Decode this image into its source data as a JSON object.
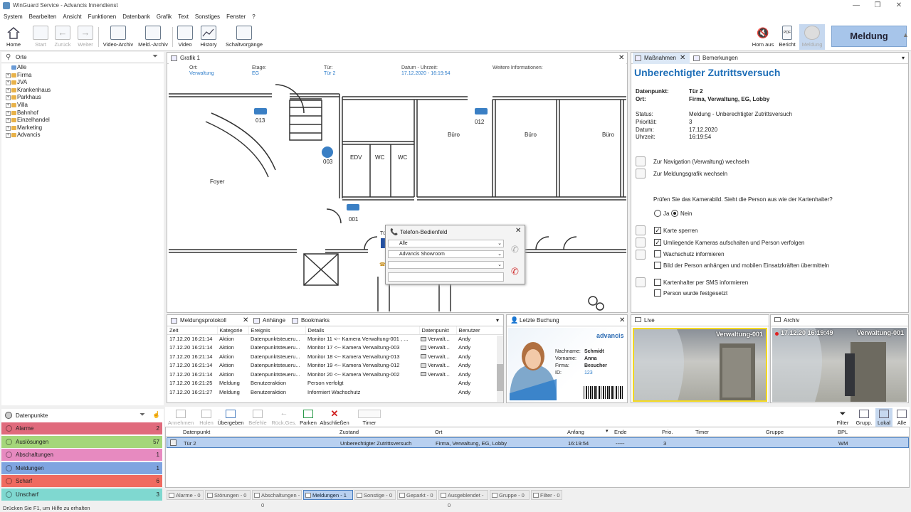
{
  "window": {
    "title": "WinGuard Service - Advancis Innendienst"
  },
  "menu": [
    "System",
    "Bearbeiten",
    "Ansicht",
    "Funktionen",
    "Datenbank",
    "Grafik",
    "Text",
    "Sonstiges",
    "Fenster",
    "?"
  ],
  "toolbar": {
    "home": "Home",
    "start": "Start",
    "back": "Zurück",
    "forward": "Weiter",
    "video_archive": "Video-Archiv",
    "event_archive": "Meld.-Archiv",
    "video": "Video",
    "history": "History",
    "switching": "Schaltvorgänge",
    "horn_off": "Horn aus",
    "report": "Bericht",
    "meldung": "Meldung",
    "meldung_big": "Meldung"
  },
  "locations": {
    "title": "Orte",
    "items": [
      "Alle",
      "Firma",
      "JVA",
      "Krankenhaus",
      "Parkhaus",
      "Villa",
      "Bahnhof",
      "Einzelhandel",
      "Marketing",
      "Advancis"
    ]
  },
  "grafik": {
    "tab": "Grafik 1",
    "info": {
      "ort_label": "Ort:",
      "ort": "Verwaltung",
      "etage_label": "Etage:",
      "etage": "EG",
      "tuer_label": "Tür:",
      "tuer": "Tür 2",
      "datum_label": "Datum - Uhrzeit:",
      "datum": "17.12.2020 - 16:19:54",
      "weitere_label": "Weitere Informationen:"
    },
    "rooms": [
      "Büro",
      "Büro",
      "Büro",
      "EDV",
      "WC",
      "WC",
      "Foyer"
    ],
    "cameras": [
      "013",
      "012",
      "003",
      "001"
    ],
    "door_label": "Tü"
  },
  "phone": {
    "title": "Telefon-Bedienfeld",
    "line1": "Alle",
    "line2": "Advancis Showroom",
    "line3": ""
  },
  "log": {
    "tabs": [
      "Meldungsprotokoll",
      "Anhänge",
      "Bookmarks"
    ],
    "columns": [
      "Zeit",
      "Kategorie",
      "Ereignis",
      "Details",
      "Datenpunkt",
      "Benutzer"
    ],
    "rows": [
      [
        "17.12.20  16:21:14",
        "Aktion",
        "Datenpunktsteueru...",
        "Monitor 11 <-- Kamera Verwaltung-001 , ...",
        "Verwalt...",
        "Andy"
      ],
      [
        "17.12.20  16:21:14",
        "Aktion",
        "Datenpunktsteueru...",
        "Monitor 17 <-- Kamera Verwaltung-003",
        "Verwalt...",
        "Andy"
      ],
      [
        "17.12.20  16:21:14",
        "Aktion",
        "Datenpunktsteueru...",
        "Monitor 18 <-- Kamera Verwaltung-013",
        "Verwalt...",
        "Andy"
      ],
      [
        "17.12.20  16:21:14",
        "Aktion",
        "Datenpunktsteueru...",
        "Monitor 19 <-- Kamera Verwaltung-012",
        "Verwalt...",
        "Andy"
      ],
      [
        "17.12.20  16:21:14",
        "Aktion",
        "Datenpunktsteueru...",
        "Monitor 20 <-- Kamera Verwaltung-002",
        "Verwalt...",
        "Andy"
      ],
      [
        "17.12.20  16:21:25",
        "Meldung",
        "Benutzeraktion",
        "Person verfolgt",
        "",
        "Andy"
      ],
      [
        "17.12.20  16:21:27",
        "Meldung",
        "Benutzeraktion",
        "Informiert Wachschutz",
        "",
        "Andy"
      ]
    ]
  },
  "booking": {
    "title": "Letzte Buchung",
    "brand": "advancis",
    "nachname_label": "Nachname:",
    "nachname": "Schmidt",
    "vorname_label": "Vorname:",
    "vorname": "Anna",
    "firma_label": "Firma:",
    "firma": "Besucher",
    "id_label": "ID:",
    "id": "123"
  },
  "measures": {
    "tabs": [
      "Maßnahmen",
      "Bemerkungen"
    ],
    "title": "Unberechtigter Zutrittsversuch",
    "datenpunkt_label": "Datenpunkt:",
    "datenpunkt": "Tür 2",
    "ort_label": "Ort:",
    "ort": "Firma, Verwaltung, EG, Lobby",
    "status_label": "Status:",
    "status": "Meldung - Unberechtigter Zutrittsversuch",
    "prioritaet_label": "Priorität:",
    "prioritaet": "3",
    "datum_label": "Datum:",
    "datum": "17.12.2020",
    "uhrzeit_label": "Uhrzeit:",
    "uhrzeit": "16:19:54",
    "nav_link": "Zur Navigation (Verwaltung) wechseln",
    "graphic_link": "Zur Meldungsgrafik wechseln",
    "question": "Prüfen Sie das Kamerabild. Sieht die Person aus wie der Kartenhalter?",
    "ja": "Ja",
    "nein": "Nein",
    "checks": [
      {
        "label": "Karte sperren",
        "checked": true
      },
      {
        "label": "Umliegende Kameras aufschalten und Person verfolgen",
        "checked": true
      },
      {
        "label": "Wachschutz informieren",
        "checked": false
      },
      {
        "label": "Bild der Person anhängen und mobilen Einsatzkräften übermitteln",
        "checked": false
      },
      {
        "label": "Kartenhalter per SMS informieren",
        "checked": false
      },
      {
        "label": "Person wurde festgesetzt",
        "checked": false
      }
    ]
  },
  "video": {
    "live_title": "Live",
    "archive_title": "Archiv",
    "live_cam": "Verwaltung-001",
    "archive_cam": "Verwaltung-001",
    "archive_time": "17.12.20  16:19:49"
  },
  "datapoints": {
    "title": "Datenpunkte",
    "items": [
      {
        "label": "Alarme",
        "count": "2",
        "color": "#e06a7c"
      },
      {
        "label": "Auslösungen",
        "count": "57",
        "color": "#a4d67a"
      },
      {
        "label": "Abschaltungen",
        "count": "1",
        "color": "#e78ac0"
      },
      {
        "label": "Meldungen",
        "count": "1",
        "color": "#7fa4e0"
      },
      {
        "label": "Scharf",
        "count": "6",
        "color": "#f06a60"
      },
      {
        "label": "Unscharf",
        "count": "3",
        "color": "#7fd8d0"
      }
    ]
  },
  "actions": {
    "annehmen": "Annehmen",
    "holen": "Holen",
    "uebergeben": "Übergeben",
    "befehle": "Befehle",
    "rueckges": "Rück.Ges.",
    "parken": "Parken",
    "abschliessen": "Abschließen",
    "timer": "Timer",
    "filter": "Filter",
    "grupp": "Grupp.",
    "lokal": "Lokal",
    "alle": "Alle"
  },
  "events": {
    "columns": [
      "Datenpunkt",
      "Zustand",
      "Ort",
      "Anfang",
      "Ende",
      "Prio.",
      "Timer",
      "Gruppe",
      "BPL"
    ],
    "row": [
      "Tür 2",
      "Unberechtigter Zutrittsversuch",
      "Firma, Verwaltung, EG, Lobby",
      "16:19:54",
      "-----",
      "3",
      "",
      "",
      "WM"
    ]
  },
  "status_tabs": [
    "Alarme - 0",
    "Störungen - 0",
    "Abschaltungen - 0",
    "Meldungen - 1",
    "Sonstige - 0",
    "Geparkt - 0",
    "Ausgeblendet - 0",
    "Gruppe - 0",
    "Filter - 0"
  ],
  "statusbar": "Drücken Sie F1, um Hilfe zu erhalten"
}
